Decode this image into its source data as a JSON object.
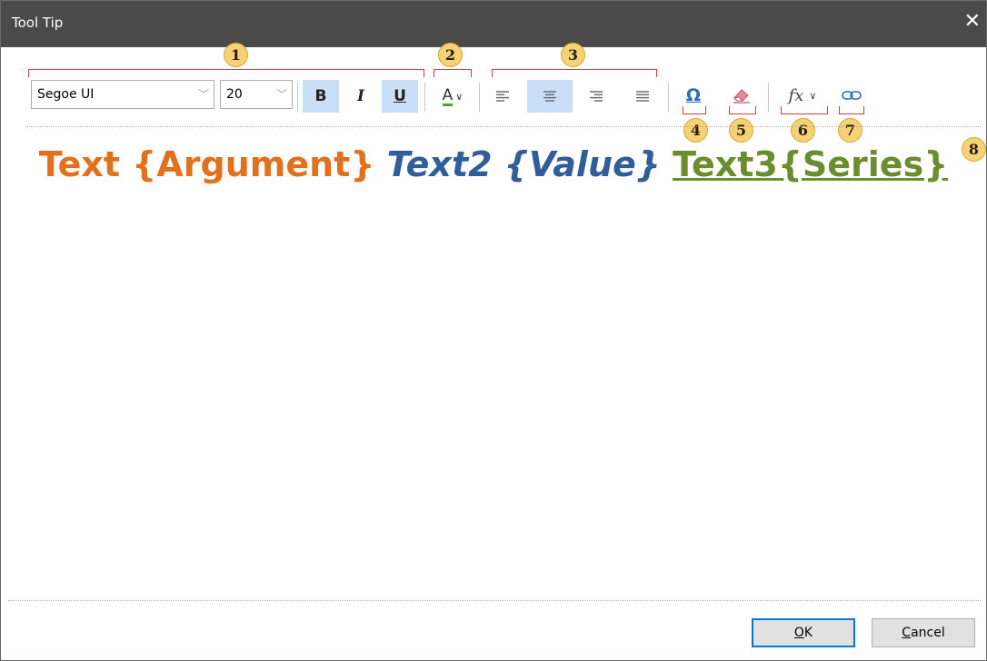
{
  "window": {
    "title": "Tool Tip",
    "close_glyph": "✕"
  },
  "toolbar": {
    "font_name": "Segoe UI",
    "font_size": "20",
    "bold_label": "B",
    "italic_label": "I",
    "underline_label": "U",
    "font_color_label": "A",
    "fx_label": "fx"
  },
  "callouts": [
    "1",
    "2",
    "3",
    "4",
    "5",
    "6",
    "7",
    "8"
  ],
  "content": {
    "part1": "Text {Argument}",
    "part2": "Text2 {Value}",
    "part3": "Text3{Series}",
    "colors": {
      "argument": "#e2711d",
      "value": "#315e9a",
      "series": "#6c8d2e"
    }
  },
  "footer": {
    "ok_accel": "O",
    "ok_rest": "K",
    "cancel_accel": "C",
    "cancel_rest": "ancel"
  },
  "icons": [
    "align-left-icon",
    "align-center-icon",
    "align-right-icon",
    "align-justify-icon",
    "omega-icon",
    "eraser-icon",
    "link-icon",
    "chevron-down-icon",
    "close-icon"
  ]
}
